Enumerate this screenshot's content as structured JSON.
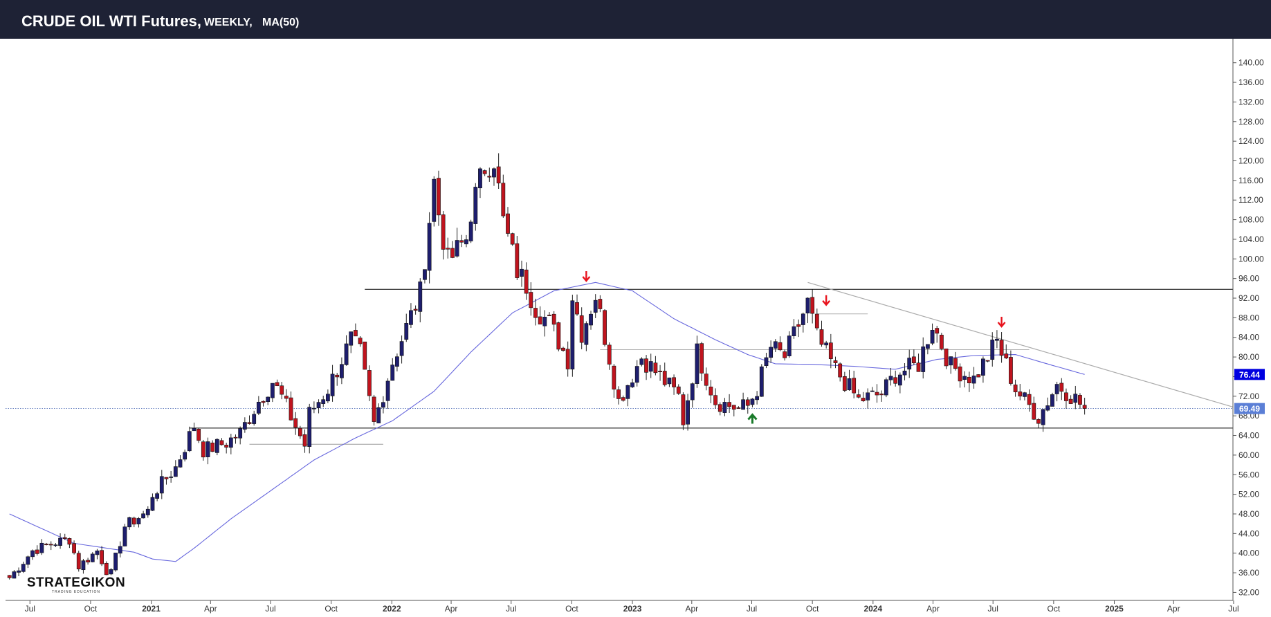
{
  "header": {
    "title": "CRUDE OIL WTI Futures,",
    "interval": "WEEKLY,",
    "indicator": "MA(50)"
  },
  "logo": {
    "name": "STRATEGIKON",
    "tagline": "TRADING EDUCATION"
  },
  "chart_data": {
    "type": "candlestick",
    "title": "CRUDE OIL WTI Futures",
    "ylim": [
      30,
      142
    ],
    "yticks": [
      32,
      36,
      40,
      44,
      48,
      52,
      56,
      60,
      64,
      68,
      72,
      76,
      80,
      84,
      88,
      92,
      96,
      100,
      104,
      108,
      112,
      116,
      120,
      124,
      128,
      132,
      136,
      140
    ],
    "ytick_labels": [
      "32.00",
      "36.00",
      "40.00",
      "44.00",
      "48.00",
      "52.00",
      "56.00",
      "60.00",
      "64.00",
      "68.00",
      "72.00",
      "76.00",
      "80.00",
      "84.00",
      "88.00",
      "92.00",
      "96.00",
      "100.00",
      "104.00",
      "108.00",
      "112.00",
      "116.00",
      "120.00",
      "124.00",
      "128.00",
      "132.00",
      "136.00",
      "140.00"
    ],
    "xlim": [
      "2020-05-25",
      "2025-06-30"
    ],
    "xticks": [
      {
        "date": "2020-07-01",
        "label": "Jul",
        "year": false
      },
      {
        "date": "2020-10-01",
        "label": "Oct",
        "year": false
      },
      {
        "date": "2021-01-01",
        "label": "2021",
        "year": true
      },
      {
        "date": "2021-04-01",
        "label": "Apr",
        "year": false
      },
      {
        "date": "2021-07-01",
        "label": "Jul",
        "year": false
      },
      {
        "date": "2021-10-01",
        "label": "Oct",
        "year": false
      },
      {
        "date": "2022-01-01",
        "label": "2022",
        "year": true
      },
      {
        "date": "2022-04-01",
        "label": "Apr",
        "year": false
      },
      {
        "date": "2022-07-01",
        "label": "Jul",
        "year": false
      },
      {
        "date": "2022-10-01",
        "label": "Oct",
        "year": false
      },
      {
        "date": "2023-01-01",
        "label": "2023",
        "year": true
      },
      {
        "date": "2023-04-01",
        "label": "Apr",
        "year": false
      },
      {
        "date": "2023-07-01",
        "label": "Jul",
        "year": false
      },
      {
        "date": "2023-10-01",
        "label": "Oct",
        "year": false
      },
      {
        "date": "2024-01-01",
        "label": "2024",
        "year": true
      },
      {
        "date": "2024-04-01",
        "label": "Apr",
        "year": false
      },
      {
        "date": "2024-07-01",
        "label": "Jul",
        "year": false
      },
      {
        "date": "2024-10-01",
        "label": "Oct",
        "year": false
      },
      {
        "date": "2025-01-01",
        "label": "2025",
        "year": true
      },
      {
        "date": "2025-04-01",
        "label": "Apr",
        "year": false
      },
      {
        "date": "2025-07-01",
        "label": "Jul",
        "year": false
      }
    ],
    "price_labels": [
      {
        "name": "ma-value",
        "value": 76.44,
        "text": "76.44",
        "color": "#0000e0"
      },
      {
        "name": "last-price",
        "value": 69.49,
        "text": "69.49",
        "color": "#5b7fd6"
      }
    ],
    "colors": {
      "up": "#1e1e6e",
      "down": "#c0141e",
      "ma": "#6666dd",
      "wick": "#222222",
      "resistance": "#000000",
      "trendline": "#aaaaaa",
      "support_minor": "#aaaaaa"
    },
    "first_date": "2020-05-31",
    "anchors": [
      [
        "2020-05-31",
        35
      ],
      [
        "2020-07-05",
        40.5
      ],
      [
        "2020-08-09",
        42.2
      ],
      [
        "2020-08-30",
        42.8
      ],
      [
        "2020-09-13",
        37.3
      ],
      [
        "2020-10-11",
        40.5
      ],
      [
        "2020-10-25",
        36.5
      ],
      [
        "2020-11-01",
        35.8
      ],
      [
        "2020-11-22",
        45.5
      ],
      [
        "2020-12-27",
        48.5
      ],
      [
        "2021-01-03",
        52
      ],
      [
        "2021-02-07",
        57.5
      ],
      [
        "2021-03-07",
        66
      ],
      [
        "2021-03-21",
        61
      ],
      [
        "2021-04-25",
        62.5
      ],
      [
        "2021-05-16",
        64.5
      ],
      [
        "2021-06-13",
        71
      ],
      [
        "2021-07-04",
        75
      ],
      [
        "2021-07-18",
        71.8
      ],
      [
        "2021-08-01",
        67.8
      ],
      [
        "2021-08-22",
        62
      ],
      [
        "2021-08-29",
        68.5
      ],
      [
        "2021-09-26",
        73.5
      ],
      [
        "2021-10-31",
        83.5
      ],
      [
        "2021-11-14",
        80.8
      ],
      [
        "2021-12-05",
        66.3
      ],
      [
        "2022-01-02",
        79
      ],
      [
        "2022-02-13",
        93
      ],
      [
        "2022-03-06",
        115.7
      ],
      [
        "2022-03-13",
        109.3
      ],
      [
        "2022-03-20",
        104.3
      ],
      [
        "2022-03-27",
        99.3
      ],
      [
        "2022-04-24",
        104.1
      ],
      [
        "2022-05-01",
        109.8
      ],
      [
        "2022-05-22",
        118.9
      ],
      [
        "2022-06-05",
        120.7
      ],
      [
        "2022-06-19",
        107.6
      ],
      [
        "2022-07-10",
        97.6
      ],
      [
        "2022-07-24",
        94.7
      ],
      [
        "2022-08-07",
        90.1
      ],
      [
        "2022-08-28",
        86.9
      ],
      [
        "2022-09-25",
        79.5
      ],
      [
        "2022-10-02",
        92.6
      ],
      [
        "2022-10-16",
        85
      ],
      [
        "2022-11-06",
        92.6
      ],
      [
        "2022-11-27",
        80
      ],
      [
        "2022-12-11",
        71
      ],
      [
        "2023-01-15",
        80
      ],
      [
        "2023-02-12",
        76
      ],
      [
        "2023-03-12",
        72
      ],
      [
        "2023-03-19",
        67
      ],
      [
        "2023-04-09",
        81
      ],
      [
        "2023-05-07",
        71
      ],
      [
        "2023-06-11",
        69.5
      ],
      [
        "2023-06-25",
        70
      ],
      [
        "2023-07-09",
        73.5
      ],
      [
        "2023-07-30",
        82
      ],
      [
        "2023-08-20",
        80
      ],
      [
        "2023-09-24",
        91
      ],
      [
        "2023-10-08",
        84
      ],
      [
        "2023-11-05",
        77.4
      ],
      [
        "2023-12-10",
        71.2
      ],
      [
        "2024-01-14",
        72.5
      ],
      [
        "2024-02-04",
        76.5
      ],
      [
        "2024-03-10",
        78.5
      ],
      [
        "2024-03-31",
        86.9
      ],
      [
        "2024-04-28",
        78.1
      ],
      [
        "2024-06-02",
        75.5
      ],
      [
        "2024-07-07",
        83.2
      ],
      [
        "2024-08-04",
        73.5
      ],
      [
        "2024-09-08",
        67.7
      ],
      [
        "2024-10-06",
        74.4
      ],
      [
        "2024-11-03",
        71.5
      ],
      [
        "2024-11-17",
        69.5
      ]
    ],
    "ma_anchors": [
      [
        "2020-05-31",
        48
      ],
      [
        "2020-09-06",
        42
      ],
      [
        "2020-12-06",
        40.2
      ],
      [
        "2021-01-03",
        38.8
      ],
      [
        "2021-02-07",
        38.3
      ],
      [
        "2021-03-07",
        41
      ],
      [
        "2021-05-02",
        47
      ],
      [
        "2021-07-04",
        53
      ],
      [
        "2021-09-05",
        59
      ],
      [
        "2021-11-07",
        63.5
      ],
      [
        "2022-01-02",
        67
      ],
      [
        "2022-03-06",
        73
      ],
      [
        "2022-05-01",
        81
      ],
      [
        "2022-07-03",
        89
      ],
      [
        "2022-09-04",
        93.5
      ],
      [
        "2022-11-06",
        95.2
      ],
      [
        "2023-01-01",
        93.5
      ],
      [
        "2023-03-05",
        87.8
      ],
      [
        "2023-05-07",
        83.5
      ],
      [
        "2023-06-25",
        80.5
      ],
      [
        "2023-08-06",
        78.6
      ],
      [
        "2023-10-01",
        78.5
      ],
      [
        "2023-12-03",
        78.1
      ],
      [
        "2024-02-04",
        77.5
      ],
      [
        "2024-04-07",
        79.5
      ],
      [
        "2024-06-02",
        80.3
      ],
      [
        "2024-08-04",
        80.5
      ],
      [
        "2024-09-29",
        78.3
      ],
      [
        "2024-11-17",
        76.44
      ]
    ],
    "lines": [
      {
        "name": "resistance-line",
        "x1": "2021-11-21",
        "y1": 93.8,
        "x2": "2025-06-30",
        "y2": 93.8,
        "stroke": "#000000",
        "w": 1
      },
      {
        "name": "support-line",
        "x1": "2021-02-28",
        "y1": 65.5,
        "x2": "2025-06-30",
        "y2": 65.5,
        "stroke": "#000000",
        "w": 1
      },
      {
        "name": "minor-support-line",
        "x1": "2021-05-30",
        "y1": 62.2,
        "x2": "2021-12-19",
        "y2": 62.2,
        "stroke": "#999999",
        "w": 1
      },
      {
        "name": "mid-range-line",
        "x1": "2022-11-13",
        "y1": 81.5,
        "x2": "2024-08-25",
        "y2": 81.5,
        "stroke": "#b0b0b0",
        "w": 1
      },
      {
        "name": "short-level-line",
        "x1": "2023-10-08",
        "y1": 88.8,
        "x2": "2023-12-24",
        "y2": 88.8,
        "stroke": "#b0b0b0",
        "w": 1
      },
      {
        "name": "descending-trendline",
        "x1": "2023-09-24",
        "y1": 95.2,
        "x2": "2025-06-30",
        "y2": 69.8,
        "stroke": "#aaaaaa",
        "w": 1.2
      }
    ],
    "arrows": [
      {
        "name": "sell-arrow-1",
        "date": "2022-10-23",
        "value": 97.5,
        "dir": "down",
        "color": "#e8141e"
      },
      {
        "name": "sell-arrow-2",
        "date": "2023-10-22",
        "value": 92.6,
        "dir": "down",
        "color": "#e8141e"
      },
      {
        "name": "sell-arrow-3",
        "date": "2024-07-14",
        "value": 88.2,
        "dir": "down",
        "color": "#e8141e"
      },
      {
        "name": "buy-arrow-1",
        "date": "2023-07-02",
        "value": 66.4,
        "dir": "up",
        "color": "#1a7a2a"
      }
    ]
  }
}
